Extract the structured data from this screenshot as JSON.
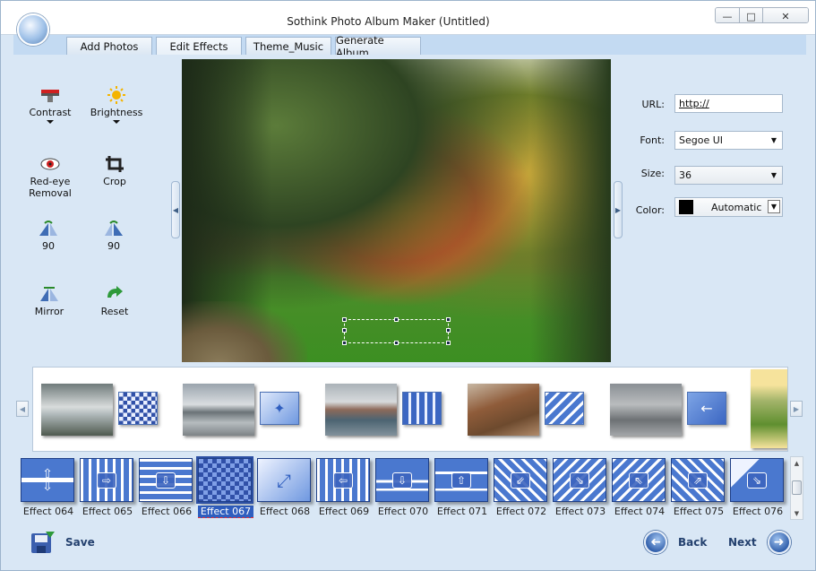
{
  "window": {
    "title": "Sothink Photo Album Maker (Untitled)",
    "controls": [
      "minimize",
      "maximize",
      "close"
    ]
  },
  "tabs": [
    {
      "label": "Add Photos"
    },
    {
      "label": "Edit Effects"
    },
    {
      "label": "Theme_Music"
    },
    {
      "label": "Generate Album"
    }
  ],
  "tools": [
    {
      "label": "Contrast",
      "icon": "contrast-icon"
    },
    {
      "label": "Brightness",
      "icon": "brightness-icon"
    },
    {
      "label": "Red-eye Removal",
      "icon": "red-eye-icon"
    },
    {
      "label": "Crop",
      "icon": "crop-icon"
    },
    {
      "label": "90",
      "icon": "rotate-left-icon"
    },
    {
      "label": "90",
      "icon": "rotate-right-icon"
    },
    {
      "label": "Mirror",
      "icon": "mirror-icon"
    },
    {
      "label": "Reset",
      "icon": "reset-icon"
    }
  ],
  "caption": {
    "url_label": "URL:",
    "url_value": "http://",
    "font_label": "Font:",
    "font_value": "Segoe UI",
    "size_label": "Size:",
    "size_value": "36",
    "color_label": "Color:",
    "color_value": "Automatic",
    "color_swatch": "#000000"
  },
  "effects": [
    {
      "label": "Effect 064",
      "selected": false
    },
    {
      "label": "Effect 065",
      "selected": false
    },
    {
      "label": "Effect 066",
      "selected": false
    },
    {
      "label": "Effect 067",
      "selected": true
    },
    {
      "label": "Effect 068",
      "selected": false
    },
    {
      "label": "Effect 069",
      "selected": false
    },
    {
      "label": "Effect 070",
      "selected": false
    },
    {
      "label": "Effect 071",
      "selected": false
    },
    {
      "label": "Effect 072",
      "selected": false
    },
    {
      "label": "Effect 073",
      "selected": false
    },
    {
      "label": "Effect 074",
      "selected": false
    },
    {
      "label": "Effect 075",
      "selected": false
    },
    {
      "label": "Effect 076",
      "selected": false
    }
  ],
  "footer": {
    "save_label": "Save",
    "back_label": "Back",
    "next_label": "Next"
  },
  "colors": {
    "panel_bg": "#d9e7f5",
    "selected_effect": "#2f5ebf"
  }
}
